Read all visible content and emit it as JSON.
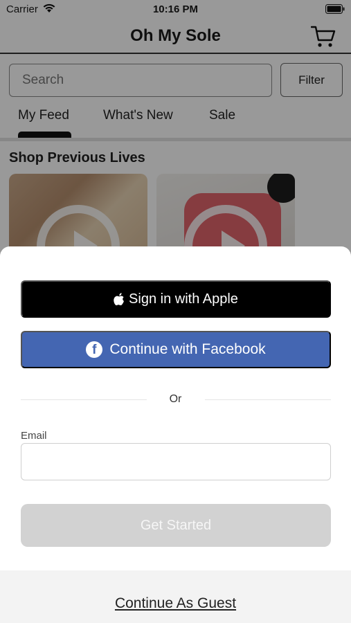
{
  "status_bar": {
    "carrier": "Carrier",
    "time": "10:16 PM"
  },
  "header": {
    "title": "Oh My Sole",
    "cart_icon": "cart-icon"
  },
  "search": {
    "placeholder": "Search",
    "filter_label": "Filter"
  },
  "tabs": [
    {
      "label": "My Feed",
      "active": true
    },
    {
      "label": "What's New",
      "active": false
    },
    {
      "label": "Sale",
      "active": false
    }
  ],
  "section": {
    "title": "Shop Previous Lives"
  },
  "sheet": {
    "apple_label": "Sign in with Apple",
    "facebook_label": "Continue with Facebook",
    "or_label": "Or",
    "email_label": "Email",
    "email_value": "",
    "get_started_label": "Get Started",
    "guest_label": "Continue As Guest"
  },
  "colors": {
    "facebook_blue": "#4466b2",
    "apple_black": "#000000",
    "disabled_gray": "#d2d2d2"
  }
}
